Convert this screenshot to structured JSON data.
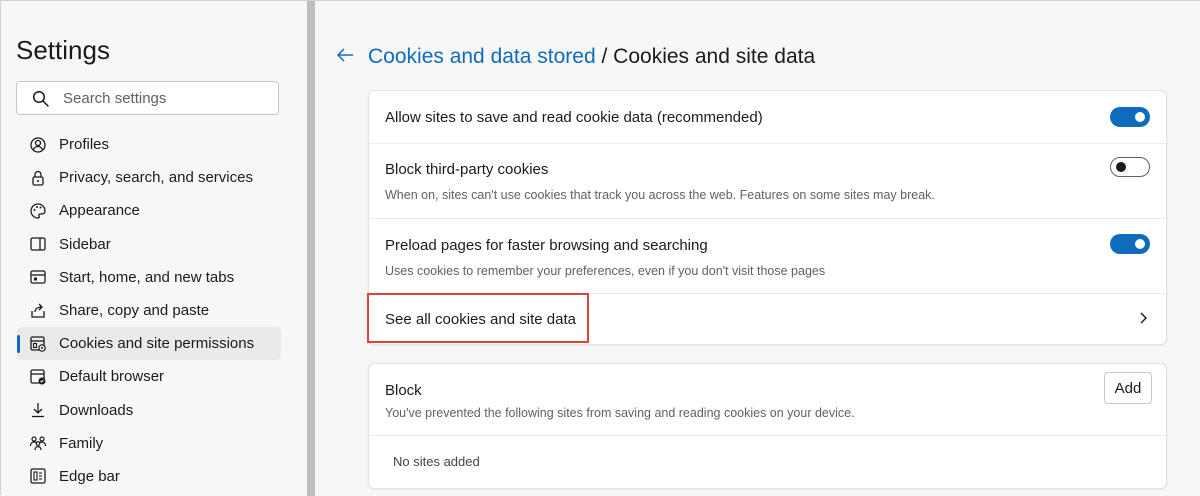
{
  "sidebar": {
    "title": "Settings",
    "search_placeholder": "Search settings",
    "items": [
      {
        "label": "Profiles",
        "icon": "profile-icon"
      },
      {
        "label": "Privacy, search, and services",
        "icon": "lock-icon"
      },
      {
        "label": "Appearance",
        "icon": "palette-icon"
      },
      {
        "label": "Sidebar",
        "icon": "sidebar-icon"
      },
      {
        "label": "Start, home, and new tabs",
        "icon": "home-tabs-icon"
      },
      {
        "label": "Share, copy and paste",
        "icon": "share-icon"
      },
      {
        "label": "Cookies and site permissions",
        "icon": "cookie-permissions-icon",
        "active": true
      },
      {
        "label": "Default browser",
        "icon": "browser-icon"
      },
      {
        "label": "Downloads",
        "icon": "download-icon"
      },
      {
        "label": "Family",
        "icon": "family-icon"
      },
      {
        "label": "Edge bar",
        "icon": "edge-bar-icon"
      }
    ]
  },
  "header": {
    "breadcrumb_link": "Cookies and data stored",
    "separator": " / ",
    "current": "Cookies and site data"
  },
  "settings": {
    "allow_cookies": {
      "title": "Allow sites to save and read cookie data (recommended)",
      "enabled": true
    },
    "block_third_party": {
      "title": "Block third-party cookies",
      "description": "When on, sites can't use cookies that track you across the web. Features on some sites may break.",
      "enabled": false
    },
    "preload": {
      "title": "Preload pages for faster browsing and searching",
      "description": "Uses cookies to remember your preferences, even if you don't visit those pages",
      "enabled": true
    },
    "see_all": {
      "title": "See all cookies and site data"
    }
  },
  "block_section": {
    "title": "Block",
    "description": "You've prevented the following sites from saving and reading cookies on your device.",
    "add_label": "Add",
    "empty_text": "No sites added"
  },
  "colors": {
    "accent": "#0f6cbd",
    "highlight": "#d9453b"
  }
}
